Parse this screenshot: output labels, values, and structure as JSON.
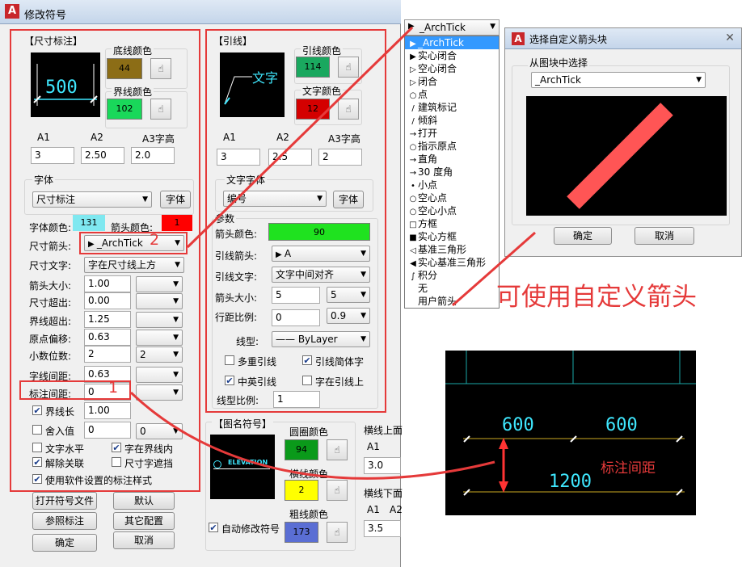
{
  "dialog": {
    "title": "修改符号",
    "dim_group": "【尺寸标注】",
    "dim_preview_value": "500",
    "base_color_label": "底线颜色",
    "base_color_value": "44",
    "ext_color_label": "界线颜色",
    "ext_color_value": "102",
    "dim_a1_label": "A1",
    "dim_a2_label": "A2",
    "dim_a3_label": "A3字高",
    "dim_a1": "3",
    "dim_a2": "2.50",
    "dim_a3": "2.0",
    "font_group": "字体",
    "font_value": "尺寸标注",
    "font_button": "字体",
    "font_color_label": "字体颜色:",
    "font_color_value": "131",
    "arrow_color_label": "箭头颜色:",
    "arrow_color_value": "1",
    "dim_arrow_label": "尺寸箭头:",
    "dim_arrow_value": "_ArchTick",
    "dim_text_label": "尺寸文字:",
    "dim_text_value": "字在尺寸线上方",
    "rows": [
      {
        "label": "箭头大小:",
        "value": "1.00",
        "extra": ""
      },
      {
        "label": "尺寸超出:",
        "value": "0.00",
        "extra": ""
      },
      {
        "label": "界线超出:",
        "value": "1.25",
        "extra": ""
      },
      {
        "label": "原点偏移:",
        "value": "0.63",
        "extra": ""
      },
      {
        "label": "小数位数:",
        "value": "2",
        "extra": "2"
      },
      {
        "label": "字线间距:",
        "value": "0.63",
        "extra": ""
      },
      {
        "label": "标注间距:",
        "value": "0",
        "extra": ""
      }
    ],
    "ext_len_label": "界线长",
    "ext_len_value": "1.00",
    "round_label": "舍入值",
    "round_value": "0",
    "round_extra": "0",
    "cb_text_horizontal": "文字水平",
    "cb_text_inside": "字在界线内",
    "cb_unassoc": "解除关联",
    "cb_dim_mask": "尺寸字遮挡",
    "cb_use_software": "使用软件设置的标注样式",
    "btn_open": "打开符号文件",
    "btn_default": "默认",
    "btn_ref": "参照标注",
    "btn_other": "其它配置",
    "btn_ok": "确定",
    "btn_cancel": "取消",
    "leader_group": "【引线】",
    "leader_preview_text": "文字",
    "leader_color_label": "引线颜色",
    "leader_color_value": "114",
    "text_color_label": "文字颜色",
    "text_color_value": "12",
    "ld_a1_label": "A1",
    "ld_a2_label": "A2",
    "ld_a3_label": "A3字高",
    "ld_a1": "3",
    "ld_a2": "2.5",
    "ld_a3": "2",
    "ld_font_group": "文字字体",
    "ld_font_value": "编号",
    "ld_font_button": "字体",
    "params_group": "参数",
    "arrow_color2_label": "箭头颜色:",
    "arrow_color2_value": "90",
    "leader_arrow_label": "引线箭头:",
    "leader_arrow_value": "A",
    "leader_text_label": "引线文字:",
    "leader_text_value": "文字中间对齐",
    "ld_arrow_size_label": "箭头大小:",
    "ld_arrow_size_value": "5",
    "ld_arrow_size_extra": "5",
    "line_spacing_label": "行距比例:",
    "line_spacing_value": "0",
    "line_spacing_extra": "0.9",
    "linetype_label": "线型:",
    "linetype_value": "ByLayer",
    "cb_multi_leader": "多重引线",
    "cb_simplified": "引线简体字",
    "cb_cn_en": "中英引线",
    "cb_on_leader": "字在引线上",
    "linetype_scale_label": "线型比例:",
    "linetype_scale_value": "1",
    "figname_group": "【图名符号】",
    "figname_preview": "ELEVATION",
    "circle_color_label": "圆圈颜色",
    "circle_color_value": "94",
    "hline_color_label": "横线颜色",
    "hline_color_value": "2",
    "thick_color_label": "粗线颜色",
    "thick_color_value": "173",
    "upper_group": "横线上面",
    "upper_a1_label": "A1",
    "upper_a1": "3.0",
    "lower_group": "横线下面",
    "lower_a1_label": "A1",
    "lower_a2_label": "A2",
    "lower_a1": "3.5",
    "cb_auto_modify": "自动修改符号"
  },
  "callouts": {
    "num2": "2",
    "num1": "1",
    "custom_arrow_note": "可使用自定义箭头",
    "spacing_note": "标注间距"
  },
  "dropdown": {
    "selected": "_ArchTick",
    "items": [
      {
        "glyph": "▶",
        "label": "_ArchTick"
      },
      {
        "glyph": "▶",
        "label": "实心闭合"
      },
      {
        "glyph": "▷",
        "label": "空心闭合"
      },
      {
        "glyph": "▷",
        "label": "闭合"
      },
      {
        "glyph": "○",
        "label": "点"
      },
      {
        "glyph": "/",
        "label": "建筑标记"
      },
      {
        "glyph": "/",
        "label": "倾斜"
      },
      {
        "glyph": "→",
        "label": "打开"
      },
      {
        "glyph": "○",
        "label": "指示原点"
      },
      {
        "glyph": "→",
        "label": "直角"
      },
      {
        "glyph": "→",
        "label": "30 度角"
      },
      {
        "glyph": "•",
        "label": "小点"
      },
      {
        "glyph": "○",
        "label": "空心点"
      },
      {
        "glyph": "○",
        "label": "空心小点"
      },
      {
        "glyph": "□",
        "label": "方框"
      },
      {
        "glyph": "■",
        "label": "实心方框"
      },
      {
        "glyph": "◁",
        "label": "基准三角形"
      },
      {
        "glyph": "◀",
        "label": "实心基准三角形"
      },
      {
        "glyph": "∫",
        "label": "积分"
      },
      {
        "glyph": "",
        "label": "无"
      },
      {
        "glyph": "",
        "label": "用户箭头"
      }
    ]
  },
  "block_dialog": {
    "title": "选择自定义箭头块",
    "group": "从图块中选择",
    "value": "_ArchTick",
    "ok": "确定",
    "cancel": "取消"
  },
  "cad_example": {
    "dim1": "600",
    "dim2": "600",
    "dim_total": "1200"
  },
  "colors": {
    "c44": "#8c6d16",
    "c102": "#19d85a",
    "c131": "#7fe8f0",
    "c1": "#ff0000",
    "c114": "#1aa85f",
    "c12": "#d40000",
    "c90": "#1fe21f",
    "c94": "#0a9a1a",
    "c2": "#ffff00",
    "c173": "#5a6ed4",
    "annot": "#e53a3a"
  }
}
